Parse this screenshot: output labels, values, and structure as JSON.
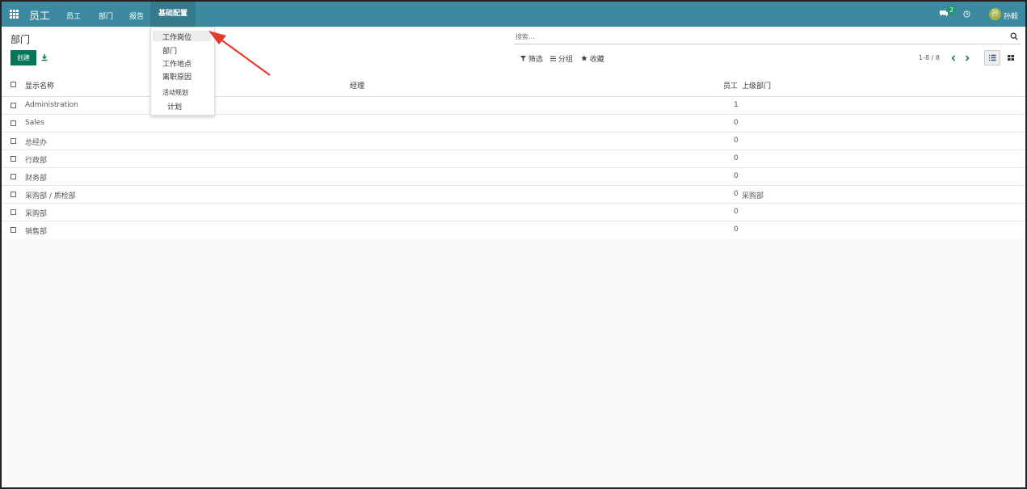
{
  "topbar": {
    "brand": "员工",
    "menu": [
      "员工",
      "部门",
      "报告",
      "基础配置"
    ],
    "chat_badge": "2",
    "user_initial": "孙",
    "user_name": "孙毅",
    "colors": {
      "bar": "#3d8aa0",
      "active": "#357a8d",
      "badge": "#1a9a6a",
      "avatar": "#a4b34a"
    }
  },
  "control": {
    "breadcrumb": "部门",
    "create_label": "创建",
    "search_placeholder": "搜索...",
    "filter_label": "筛选",
    "group_label": "分组",
    "favorite_label": "收藏",
    "pager": "1-8 / 8"
  },
  "table": {
    "headers": {
      "name": "显示名称",
      "manager": "经理",
      "employees": "员工",
      "parent": "上级部门"
    },
    "rows": [
      {
        "name": "Administration",
        "manager": "",
        "employees": "1",
        "parent": ""
      },
      {
        "name": "Sales",
        "manager": "",
        "employees": "0",
        "parent": ""
      },
      {
        "name": "总经办",
        "manager": "",
        "employees": "0",
        "parent": ""
      },
      {
        "name": "行政部",
        "manager": "",
        "employees": "0",
        "parent": ""
      },
      {
        "name": "财务部",
        "manager": "",
        "employees": "0",
        "parent": ""
      },
      {
        "name": "采购部 / 质检部",
        "manager": "",
        "employees": "0",
        "parent": "采购部"
      },
      {
        "name": "采购部",
        "manager": "",
        "employees": "0",
        "parent": ""
      },
      {
        "name": "销售部",
        "manager": "",
        "employees": "0",
        "parent": ""
      }
    ]
  },
  "dropdown": {
    "items": [
      "工作岗位",
      "部门",
      "工作地点",
      "离职原因",
      "活动规划",
      "计划"
    ],
    "highlighted": "工作岗位"
  },
  "annotation": {
    "arrow_color": "#e8382e"
  }
}
